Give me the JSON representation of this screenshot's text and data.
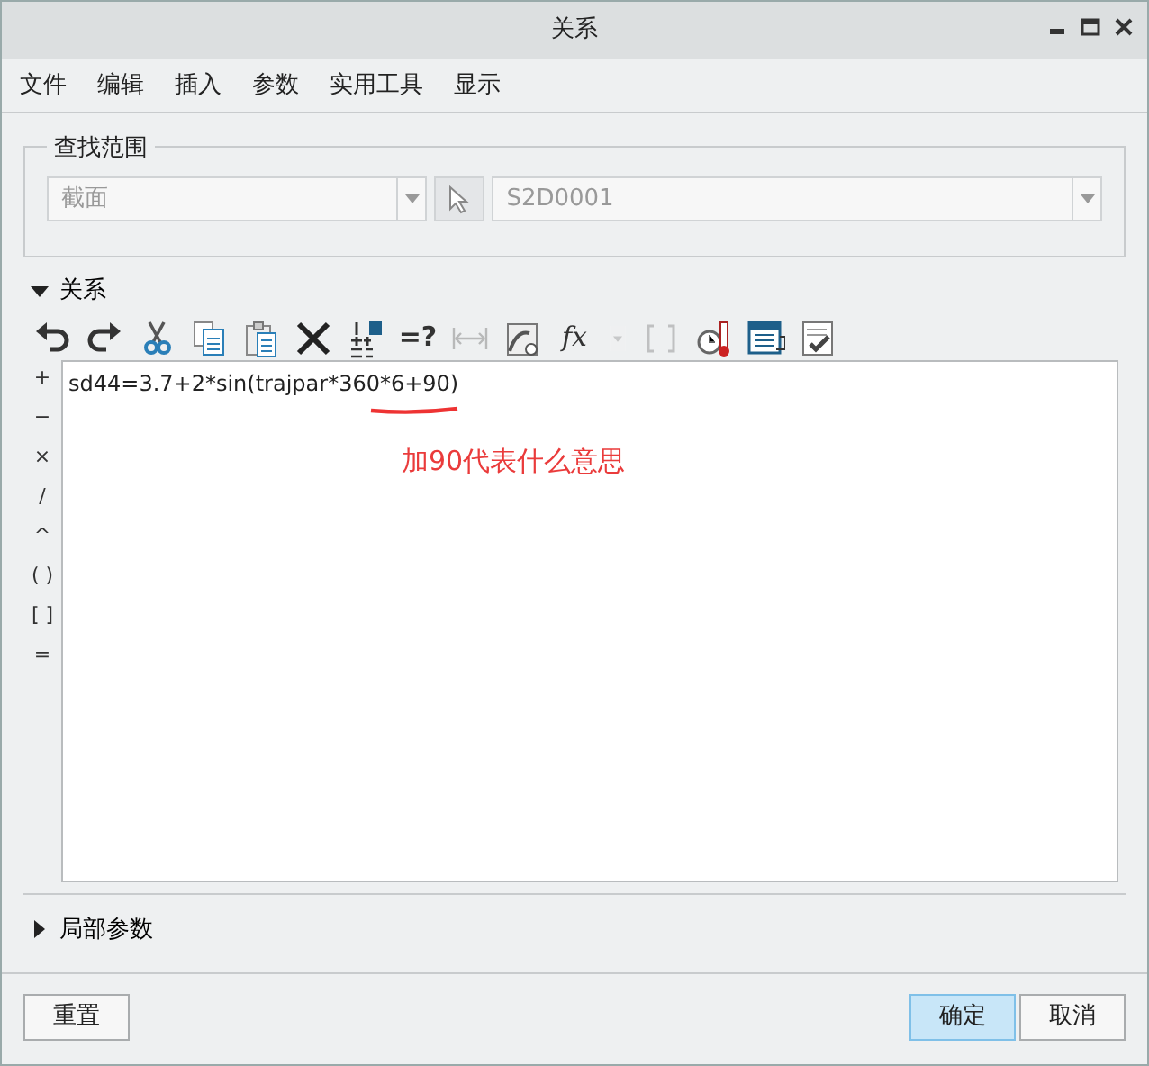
{
  "window": {
    "title": "关系"
  },
  "menu": [
    "文件",
    "编辑",
    "插入",
    "参数",
    "实用工具",
    "显示"
  ],
  "search_scope": {
    "legend": "查找范围",
    "type_field": {
      "value": "截面",
      "disabled": true
    },
    "name_field": {
      "value": "S2D0001",
      "disabled": true
    }
  },
  "relations": {
    "header": "关系",
    "expanded": true,
    "toolbar": [
      {
        "kind": "undo",
        "disabled": false
      },
      {
        "kind": "redo",
        "disabled": false
      },
      {
        "kind": "cut",
        "disabled": false
      },
      {
        "kind": "copy",
        "disabled": false
      },
      {
        "kind": "paste",
        "disabled": false
      },
      {
        "kind": "delete",
        "disabled": false
      },
      {
        "kind": "units",
        "disabled": false
      },
      {
        "kind": "evaluate",
        "label": "=?",
        "disabled": false
      },
      {
        "kind": "measure",
        "disabled": true
      },
      {
        "kind": "graph",
        "disabled": false
      },
      {
        "kind": "function",
        "label": "fx",
        "disabled": false
      },
      {
        "kind": "dropdown",
        "disabled": true
      },
      {
        "kind": "brackets",
        "disabled": true
      },
      {
        "kind": "thermo",
        "disabled": false
      },
      {
        "kind": "list",
        "disabled": false
      },
      {
        "kind": "check",
        "disabled": false
      }
    ],
    "operators": [
      "+",
      "−",
      "×",
      "/",
      "^",
      "( )",
      "[ ]",
      "="
    ],
    "editor_text": "sd44=3.7+2*sin(trajpar*360*6+90)",
    "annotation": "加90代表什么意思"
  },
  "local_params": {
    "header": "局部参数",
    "expanded": false
  },
  "buttons": [
    {
      "label": "重置",
      "kind": "reset",
      "default": false
    },
    {
      "label": "确定",
      "kind": "ok",
      "default": true
    },
    {
      "label": "取消",
      "kind": "cancel",
      "default": false
    }
  ]
}
